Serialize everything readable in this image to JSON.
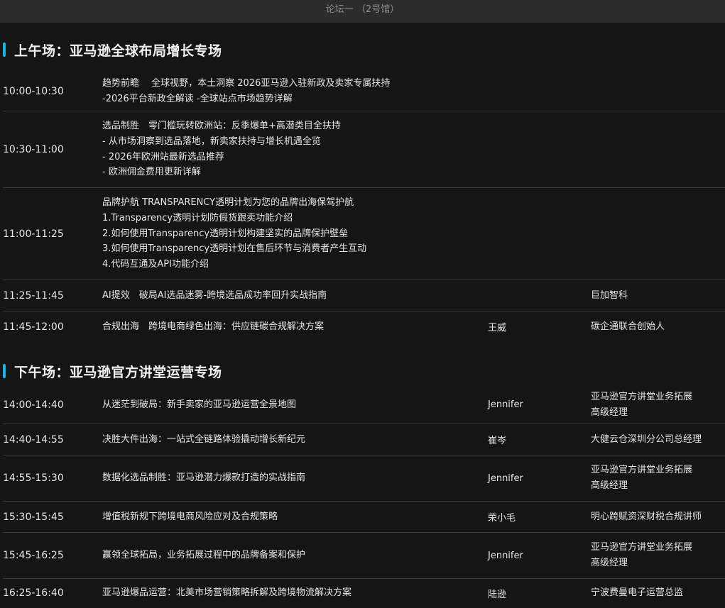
{
  "header": {
    "title": "论坛一 （2号馆）"
  },
  "morning": {
    "title": "上午场：亚马逊全球布局增长专场",
    "rows": [
      {
        "time": "10:00-10:30",
        "lines": [
          "趋势前瞻　 全球视野，本土洞察 2026亚马逊入驻新政及卖家专属扶持",
          "-2026平台新政全解读  -全球站点市场趋势详解"
        ],
        "speaker": "",
        "role": []
      },
      {
        "time": "10:30-11:00",
        "lines": [
          "选品制胜　零门槛玩转欧洲站：反季爆单+高潜类目全扶持",
          "- 从市场洞察到选品落地，新卖家扶持与增长机遇全览",
          "- 2026年欧洲站最新选品推荐",
          "- 欧洲佣金费用更新详解"
        ],
        "speaker": "",
        "role": []
      },
      {
        "time": "11:00-11:25",
        "lines": [
          "品牌护航  TRANSPARENCY透明计划为您的品牌出海保驾护航",
          "1.Transparency透明计划防假货跟卖功能介绍",
          "2.如何使用Transparency透明计划构建坚实的品牌保护壁垒",
          "3.如何使用Transparency透明计划在售后环节与消费者产生互动",
          "4.代码互通及API功能介绍"
        ],
        "speaker": "",
        "role": []
      },
      {
        "time": "11:25-11:45",
        "lines": [
          "AI提效　破局AI选品迷雾-跨境选品成功率回升实战指南"
        ],
        "speaker": "",
        "role": [
          "巨加智科"
        ]
      },
      {
        "time": "11:45-12:00",
        "lines": [
          "合规出海　跨境电商绿色出海：供应链碳合规解决方案"
        ],
        "speaker": "王威",
        "role": [
          "碳企通联合创始人"
        ]
      }
    ]
  },
  "afternoon": {
    "title": "下午场：亚马逊官方讲堂运营专场",
    "rows": [
      {
        "time": "14:00-14:40",
        "lines": [
          "从迷茫到破局：新手卖家的亚马逊运营全景地图"
        ],
        "speaker": "Jennifer",
        "role": [
          "亚马逊官方讲堂业务拓展",
          "高级经理"
        ]
      },
      {
        "time": "14:40-14:55",
        "lines": [
          "决胜大件出海：一站式全链路体验撬动增长新纪元"
        ],
        "speaker": "崔岑",
        "role": [
          "大健云仓深圳分公司总经理"
        ]
      },
      {
        "time": "14:55-15:30",
        "lines": [
          "数据化选品制胜：亚马逊潜力爆款打造的实战指南"
        ],
        "speaker": "Jennifer",
        "role": [
          "亚马逊官方讲堂业务拓展",
          "高级经理"
        ]
      },
      {
        "time": "15:30-15:45",
        "lines": [
          "增值税新规下跨境电商风险应对及合规策略"
        ],
        "speaker": "荣小毛",
        "role": [
          "明心跨赋资深财税合规讲师"
        ]
      },
      {
        "time": "15:45-16:25",
        "lines": [
          "赢领全球拓局，业务拓展过程中的品牌备案和保护"
        ],
        "speaker": "Jennifer",
        "role": [
          "亚马逊官方讲堂业务拓展",
          "高级经理"
        ]
      },
      {
        "time": "16:25-16:40",
        "lines": [
          "亚马逊爆品运营：北美市场营销策略拆解及跨境物流解决方案"
        ],
        "speaker": "陆逊",
        "role": [
          "宁波费曼电子运营总监"
        ]
      }
    ]
  }
}
